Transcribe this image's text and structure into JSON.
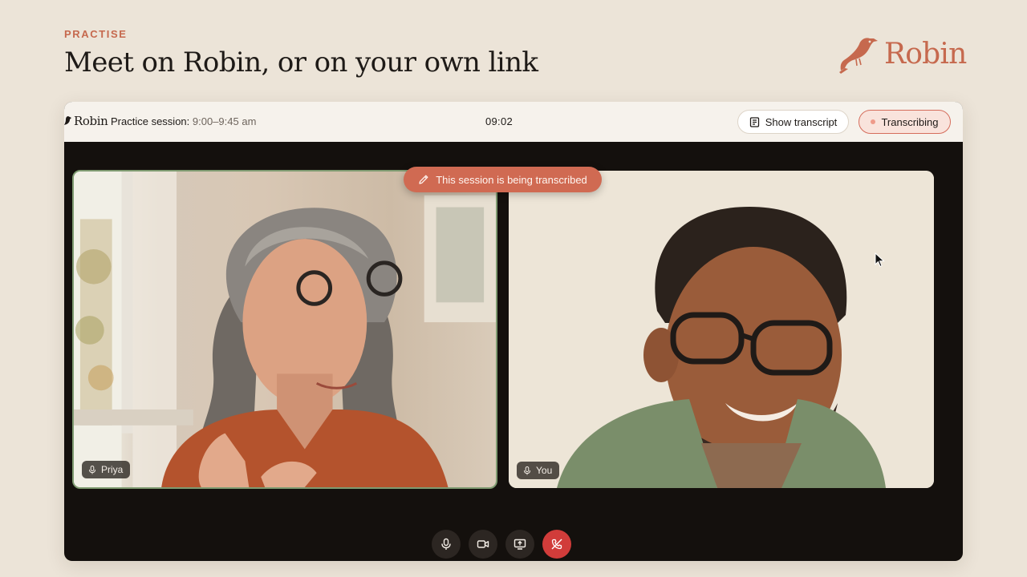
{
  "header": {
    "eyebrow": "PRACTISE",
    "title": "Meet on Robin, or on your own link",
    "brand_name": "Robin",
    "brand_icon": "robin-bird-icon",
    "brand_color": "#c6694e"
  },
  "call": {
    "mini_logo": "Robin",
    "session_label": "Practice session",
    "session_time": "9:00–9:45 am",
    "clock": "09:02",
    "show_transcript_label": "Show transcript",
    "transcribing_label": "Transcribing",
    "transcribe_notice": "This session is being transcribed",
    "participants": [
      {
        "name": "Priya",
        "mic_icon": "microphone-icon",
        "active_speaker": true
      },
      {
        "name": "You",
        "mic_icon": "microphone-icon",
        "active_speaker": false
      }
    ],
    "controls": [
      {
        "name": "microphone",
        "icon": "microphone-icon"
      },
      {
        "name": "camera",
        "icon": "video-camera-icon"
      },
      {
        "name": "share-screen",
        "icon": "screen-share-icon"
      },
      {
        "name": "end-call",
        "icon": "hang-up-icon",
        "color": "#d13c3a"
      }
    ],
    "accent_color": "#d06a52"
  }
}
